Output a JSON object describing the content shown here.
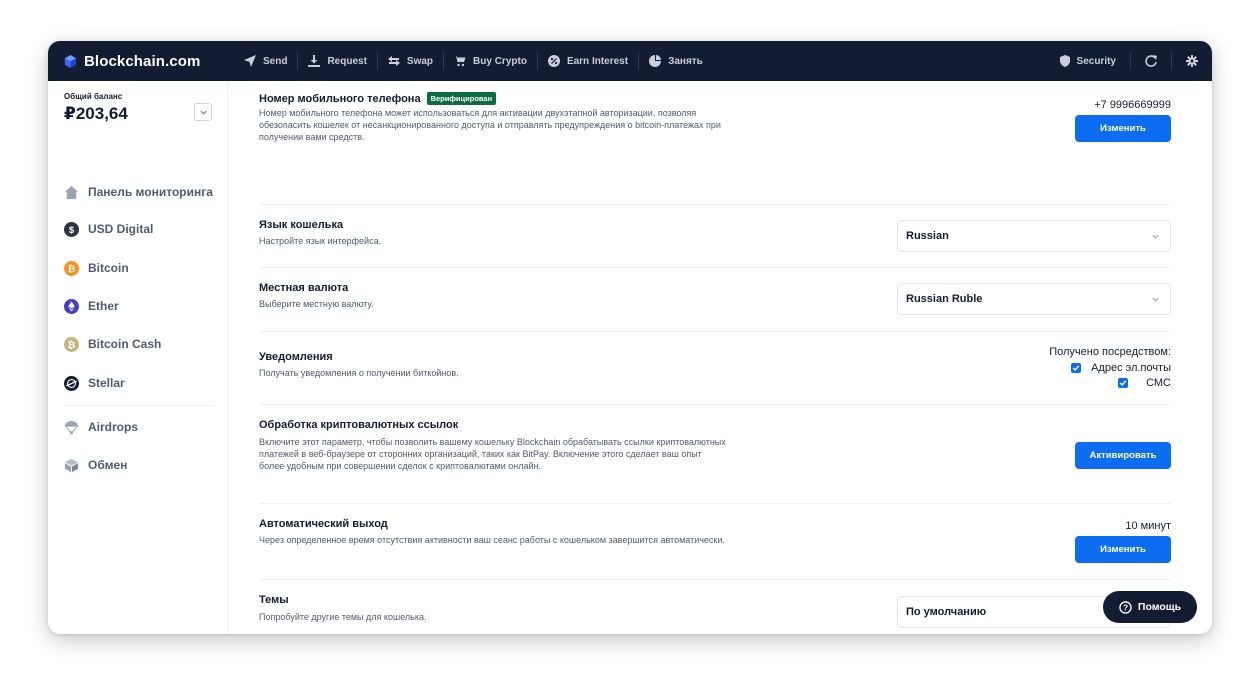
{
  "app": {
    "brand": "Blockchain.com",
    "nav": [
      {
        "label": "Send",
        "icon": "send-icon"
      },
      {
        "label": "Request",
        "icon": "download-icon"
      },
      {
        "label": "Swap",
        "icon": "swap-icon"
      },
      {
        "label": "Buy Crypto",
        "icon": "cart-icon"
      },
      {
        "label": "Earn Interest",
        "icon": "percent-icon"
      },
      {
        "label": "Занять",
        "icon": "pie-icon"
      }
    ],
    "tools": {
      "security_label": "Security"
    }
  },
  "sidebar": {
    "balance_label": "Общий баланс",
    "balance_value": "₽203,64",
    "items": [
      {
        "label": "Панель мониторинга",
        "icon": "home-icon"
      },
      {
        "label": "USD Digital",
        "icon": "usd-digital-icon",
        "color": "#2c3442"
      },
      {
        "label": "Bitcoin",
        "icon": "bitcoin-icon",
        "color": "#f7931a"
      },
      {
        "label": "Ether",
        "icon": "ether-icon",
        "color": "#473bcb"
      },
      {
        "label": "Bitcoin Cash",
        "icon": "bitcoin-cash-icon",
        "color": "#c9b27c"
      },
      {
        "label": "Stellar",
        "icon": "stellar-icon",
        "color": "#121d33"
      },
      {
        "label": "Airdrops",
        "icon": "parachute-icon"
      },
      {
        "label": "Обмен",
        "icon": "exchange-icon"
      }
    ]
  },
  "settings": {
    "phone": {
      "title": "Номер мобильного телефона",
      "badge": "Верифицирован",
      "desc": "Номер мобильного телефона может использоваться для активации двухэтапной авторизации, позволяя обезопасить кошелек от несанкционированного доступа и отправлять предупреждения о bitcoin-платежах при получении вами средств.",
      "value": "+7 9996669999",
      "button": "Изменить"
    },
    "language": {
      "title": "Язык кошелька",
      "desc": "Настройте язык интерфейса.",
      "selected": "Russian"
    },
    "currency": {
      "title": "Местная валюта",
      "desc": "Выберите местную валюту.",
      "selected": "Russian Ruble"
    },
    "notifications": {
      "title": "Уведомления",
      "desc": "Получать уведомления о получении биткойнов.",
      "received_via": "Получено посредством:",
      "email_label": "Адрес эл.почты",
      "sms_label": "СМС"
    },
    "crypto_links": {
      "title": "Обработка криптовалютных ссылок",
      "desc": "Включите этот параметр, чтобы позволить вашему кошельку Blockchain обрабатывать ссылки криптовалютных платежей в веб-браузере от сторонних организаций, таких как BitPay. Включение этого сделает ваш опыт более удобным при совершении сделок с криптовалютами онлайн.",
      "button": "Активировать"
    },
    "auto_logout": {
      "title": "Автоматический выход",
      "desc": "Через определенное время отсутствия активности ваш сеанс работы с кошельком завершится автоматически.",
      "value": "10 минут",
      "button": "Изменить"
    },
    "themes": {
      "title": "Темы",
      "desc": "Попробуйте другие темы для кошелька.",
      "selected": "По умолчанию"
    }
  },
  "help": {
    "label": "Помощь"
  },
  "colors": {
    "topbar": "#121d33",
    "accent": "#0c6cf2",
    "verified": "#0c6c3f"
  }
}
